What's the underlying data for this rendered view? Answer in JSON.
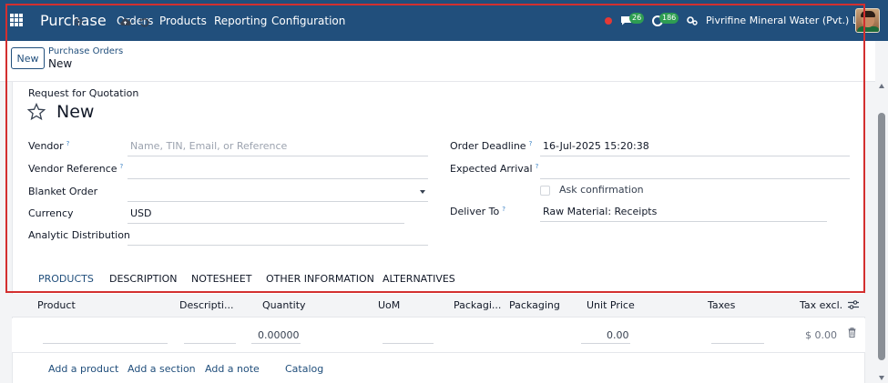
{
  "navbar": {
    "brand": "Purchase",
    "menu": [
      "Orders",
      "Products",
      "Reporting",
      "Configuration"
    ],
    "chat_badge": "26",
    "activity_badge": "186",
    "company": "Pivrifine Mineral Water (Pvt.) Ltd."
  },
  "control": {
    "new_label": "New",
    "breadcrumb": "Purchase Orders",
    "current": "New"
  },
  "form": {
    "rfq_label": "Request for Quotation",
    "record_name": "New",
    "vendor_label": "Vendor",
    "vendor_placeholder": "Name, TIN, Email, or Reference",
    "vendor_reference_label": "Vendor Reference",
    "blanket_order_label": "Blanket Order",
    "currency_label": "Currency",
    "currency_value": "USD",
    "analytic_label": "Analytic Distribution",
    "order_deadline_label": "Order Deadline",
    "order_deadline_value": "16-Jul-2025 15:20:38",
    "expected_arrival_label": "Expected Arrival",
    "ask_confirmation_label": "Ask confirmation",
    "deliver_to_label": "Deliver To",
    "deliver_to_value": "Raw Material: Receipts",
    "help_mark": "?"
  },
  "tabs": [
    "PRODUCTS",
    "DESCRIPTION",
    "NOTESHEET",
    "OTHER INFORMATION",
    "ALTERNATIVES"
  ],
  "table": {
    "headers": [
      "Product",
      "Descripti...",
      "Quantity",
      "UoM",
      "Packagi...",
      "Packaging",
      "Unit Price",
      "Taxes",
      "Tax excl."
    ],
    "row": {
      "quantity": "0.00000",
      "unit_price": "0.00",
      "tax_excl": "$ 0.00"
    },
    "links": [
      "Add a product",
      "Add a section",
      "Add a note",
      "Catalog"
    ]
  },
  "colors": {
    "navbar": "#214f7c",
    "highlight": "#d32f2f",
    "badge": "#2e9d52"
  }
}
